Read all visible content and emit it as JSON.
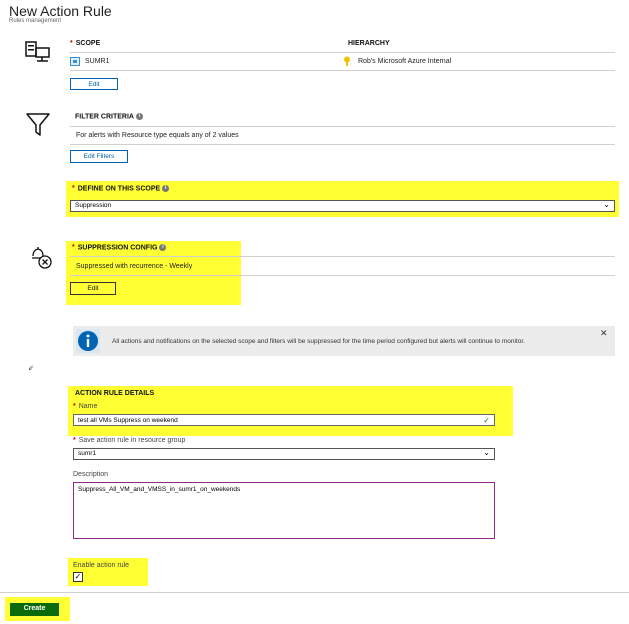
{
  "header": {
    "title": "New Action Rule",
    "subtitle": "Rules management"
  },
  "scope": {
    "label": "SCOPE",
    "hierarchy_label": "HIERARCHY",
    "resource": "SUMR1",
    "hierarchy_value": "Rob's Microsoft Azure Internal",
    "edit_label": "Edit"
  },
  "filter": {
    "label": "FILTER CRITERIA",
    "text": "For alerts with Resource type equals any of 2 values",
    "edit_label": "Edit Filters"
  },
  "define": {
    "label": "DEFINE ON THIS SCOPE",
    "selected": "Suppression"
  },
  "suppression": {
    "label": "SUPPRESSION CONFIG",
    "text": "Suppressed with recurrence - Weekly",
    "edit_label": "Edit"
  },
  "banner": {
    "text": "All actions and notifications on the selected scope and filters will be suppressed for the time period configured but alerts will continue to monitor.",
    "close": "✕"
  },
  "details": {
    "label": "ACTION RULE DETAILS",
    "name_label": "Name",
    "name_value": "test all VMs Suppress on weekend",
    "rg_label": "Save action rule in resource group",
    "rg_value": "sumr1",
    "desc_label": "Description",
    "desc_value": "Suppress_All_VM_and_VMSS_in_sumr1_on_weekends",
    "enable_label": "Enable action rule",
    "enabled": true
  },
  "footer": {
    "create_label": "Create"
  },
  "colors": {
    "highlight": "#ffff33",
    "link": "#0063b1",
    "create": "#0b6a0b",
    "info": "#0063b1"
  }
}
